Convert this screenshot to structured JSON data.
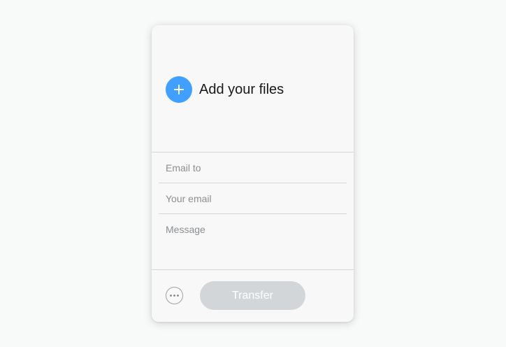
{
  "upload": {
    "add_icon": "plus-icon",
    "label": "Add your files"
  },
  "form": {
    "email_to_placeholder": "Email to",
    "your_email_placeholder": "Your email",
    "message_placeholder": "Message"
  },
  "footer": {
    "more_icon": "more-options-icon",
    "transfer_label": "Transfer"
  },
  "colors": {
    "accent": "#409fff",
    "button_disabled": "#d3d6d8",
    "placeholder": "#8a8e91",
    "divider": "#d4d7d9"
  }
}
